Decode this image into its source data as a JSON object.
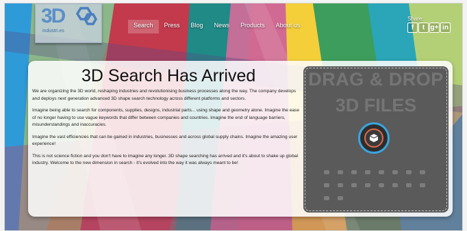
{
  "logo": {
    "mark": "3D",
    "subtitle": "industri.es"
  },
  "nav": {
    "items": [
      {
        "label": "Search",
        "active": true
      },
      {
        "label": "Press",
        "active": false
      },
      {
        "label": "Blog",
        "active": false
      },
      {
        "label": "News",
        "active": false
      },
      {
        "label": "Products",
        "active": false
      },
      {
        "label": "About us",
        "active": false
      }
    ]
  },
  "share": {
    "label": "Share:",
    "icons": [
      {
        "name": "facebook-icon",
        "glyph": "f"
      },
      {
        "name": "twitter-icon",
        "glyph": "t"
      },
      {
        "name": "google-plus-icon",
        "glyph": "g+"
      },
      {
        "name": "linkedin-icon",
        "glyph": "in"
      }
    ]
  },
  "main": {
    "title": "3D Search Has Arrived",
    "paragraphs": [
      "We are organizing the 3D world, reshaping industries and revolutionising business processes along the way. The company develops and deploys next generation advanced 3D shape search technology across different platforms and sectors.",
      "Imagine being able to search for components, supplies, designs, industrial parts... using shape and geometry alone. Imagine the ease of no longer having to use vague keywords that differ between companies and countries. Imagine the end of language barriers, misunderstandings and inaccuracies.",
      "Imagine the vast efficiencies that can be gained in industries, businesses and across global supply chains. Imagine the amazing user experience!",
      "This is not science fiction and you don't have to imagine any longer. 3D shape searching has arrived and it's about to shake up global industry. Welcome to the new dimension in search - it's evolved into the way it was always meant to be!"
    ]
  },
  "dropzone": {
    "line1": "DRAG & DROP",
    "line2": "3D FILES"
  },
  "colors": {
    "accent_blue": "#3aa5e0",
    "dropzone_bg": "#5a5a5a",
    "accent_orange": "#e06a4a"
  }
}
